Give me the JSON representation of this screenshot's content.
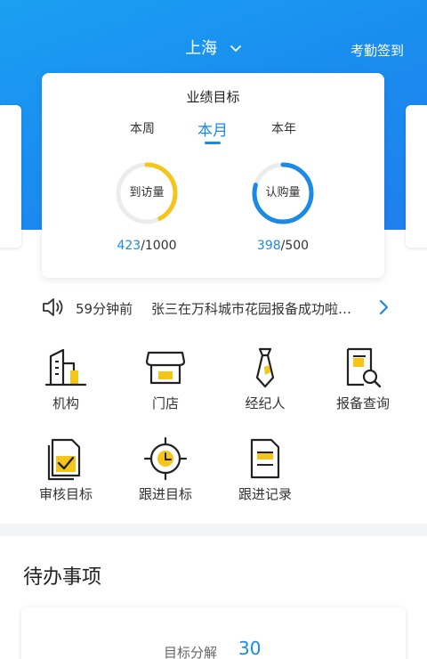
{
  "header": {
    "city": "上海",
    "checkin_label": "考勤签到"
  },
  "performance": {
    "title": "业绩目标",
    "tabs": [
      {
        "label": "本周",
        "active": false
      },
      {
        "label": "本月",
        "active": true
      },
      {
        "label": "本年",
        "active": false
      }
    ],
    "gauges": [
      {
        "label": "到访量",
        "current": "423",
        "target": "/1000",
        "progress": 0.423,
        "color": "#f5c518"
      },
      {
        "label": "认购量",
        "current": "398",
        "target": "/500",
        "progress": 0.796,
        "color": "#1a8ae6"
      }
    ]
  },
  "notice": {
    "time": "59分钟前",
    "text": "张三在万科城市花园报备成功啦…"
  },
  "grid": [
    {
      "label": "机构",
      "icon": "building-icon"
    },
    {
      "label": "门店",
      "icon": "store-icon"
    },
    {
      "label": "经纪人",
      "icon": "agent-tie-icon"
    },
    {
      "label": "报备查询",
      "icon": "document-search-icon"
    },
    {
      "label": "审核目标",
      "icon": "audit-check-icon"
    },
    {
      "label": "跟进目标",
      "icon": "target-clock-icon"
    },
    {
      "label": "跟进记录",
      "icon": "record-document-icon"
    }
  ],
  "todo": {
    "title": "待办事项",
    "items": [
      {
        "label": "目标分解",
        "count": "30"
      }
    ]
  },
  "colors": {
    "primary": "#1a8ae6",
    "accent_yellow": "#f5c518",
    "header_gradient_start": "#1aa0f2",
    "header_gradient_end": "#1f7fee"
  }
}
